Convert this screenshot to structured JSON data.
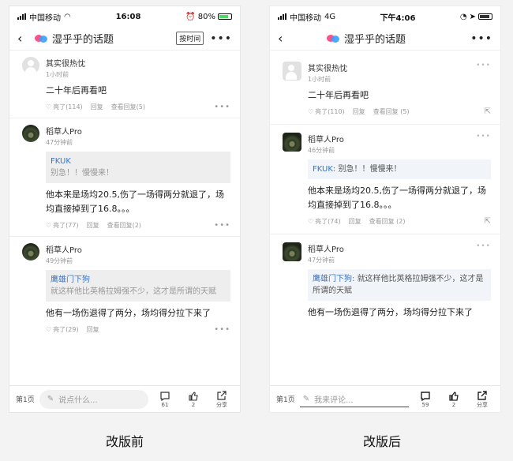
{
  "left": {
    "status": {
      "carrier": "中国移动",
      "time": "16:08",
      "battery": "80%"
    },
    "nav": {
      "title": "湿乎乎的话题",
      "sort": "按时间"
    },
    "comments": [
      {
        "name": "其实很热忱",
        "time": "1小时前",
        "text": "二十年后再看吧",
        "likes": "亮了(114)",
        "reply": "回复",
        "view": "查看回复(5)"
      },
      {
        "name": "稻草人Pro",
        "time": "47分钟前",
        "quote_name": "FKUK",
        "quote": "别急！！慢慢来！",
        "text": "他本来是场均20.5,伤了一场得两分就退了，场均直接掉到了16.8。。。",
        "likes": "亮了(77)",
        "reply": "回复",
        "view": "查看回复(2)"
      },
      {
        "name": "稻草人Pro",
        "time": "49分钟前",
        "quote_name": "鹰雄门下狗",
        "quote": "就这样他比英格拉姆强不少，这才是所谓的天赋",
        "text": "他有一场伤退得了两分，场均得分拉下来了",
        "likes": "亮了(29)",
        "reply": "回复"
      }
    ],
    "bottom": {
      "page": "第1页",
      "placeholder": "说点什么...",
      "comments": "61",
      "likes": "2",
      "share": "分享"
    }
  },
  "right": {
    "status": {
      "carrier": "中国移动",
      "net": "4G",
      "time": "下午4:06"
    },
    "nav": {
      "title": "湿乎乎的话题"
    },
    "comments": [
      {
        "name": "其实很热忱",
        "time": "1小时前",
        "text": "二十年后再看吧",
        "likes": "亮了(110)",
        "reply": "回复",
        "view": "查看回复 (5)"
      },
      {
        "name": "稻草人Pro",
        "time": "46分钟前",
        "quote_name": "FKUK:",
        "quote": "别急！！慢慢来！",
        "text": "他本来是场均20.5,伤了一场得两分就退了，场均直接掉到了16.8。。。",
        "likes": "亮了(74)",
        "reply": "回复",
        "view": "查看回复 (2)"
      },
      {
        "name": "稻草人Pro",
        "time": "47分钟前",
        "quote_name": "鹰雄门下狗:",
        "quote": "就这样他比英格拉姆强不少，这才是所谓的天赋",
        "text": "他有一场伤退得了两分，场均得分拉下来了"
      }
    ],
    "bottom": {
      "page": "第1页",
      "placeholder": "我来评论...",
      "comments": "59",
      "likes": "2",
      "share": "分享"
    }
  },
  "captions": {
    "before": "改版前",
    "after": "改版后"
  }
}
